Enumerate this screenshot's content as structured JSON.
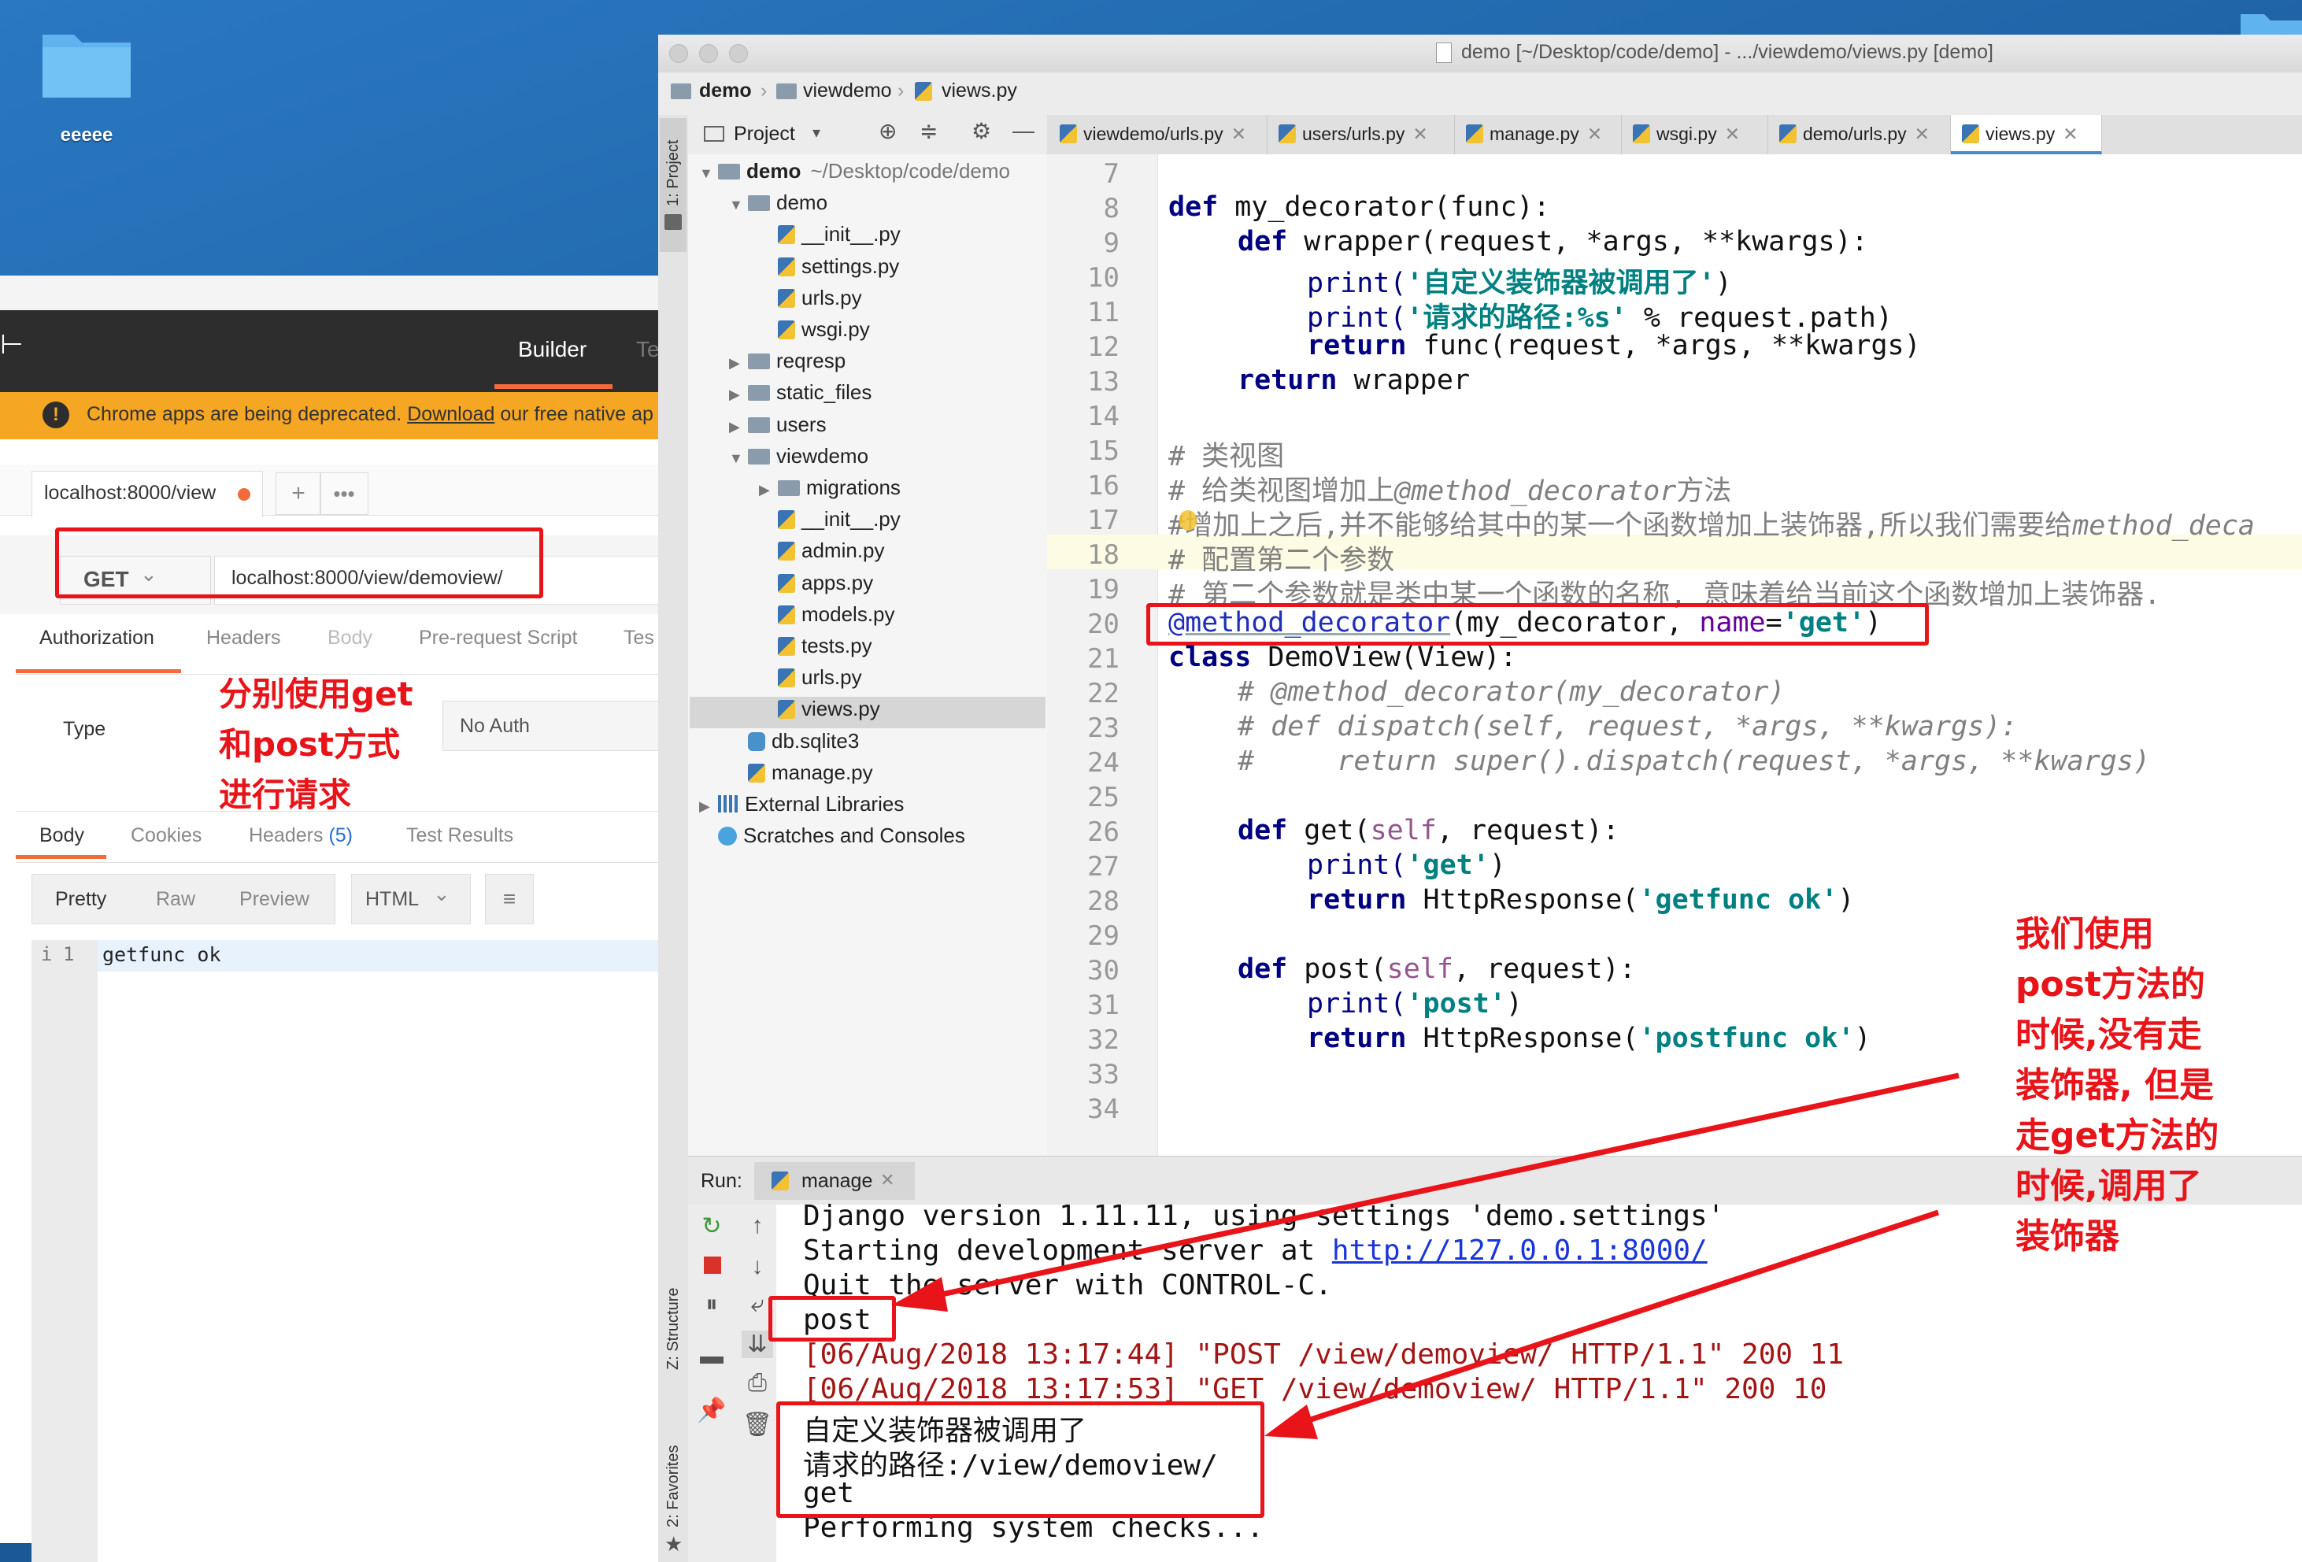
{
  "desktop": {
    "folder_label": "eeeee"
  },
  "postman": {
    "builder_tab": "Builder",
    "partial_tab": "Te",
    "banner": {
      "text_before": "Chrome apps are being deprecated.",
      "link": "Download",
      "text_after": "our free native ap"
    },
    "request_tab": "localhost:8000/view",
    "method": "GET",
    "url": "localhost:8000/view/demoview/",
    "request_tabs": [
      "Authorization",
      "Headers",
      "Body",
      "Pre-request Script",
      "Tes"
    ],
    "auth_type_label": "Type",
    "auth_type_value": "No Auth",
    "annotation": [
      "分别使用get",
      "和post方式",
      "进行请求"
    ],
    "response_tabs": {
      "body": "Body",
      "cookies": "Cookies",
      "headers": "Headers",
      "headers_count": "(5)",
      "test_results": "Test Results"
    },
    "formats": [
      "Pretty",
      "Raw",
      "Preview"
    ],
    "format_select": "HTML",
    "response_line_no": "1",
    "response_body": "getfunc ok"
  },
  "pycharm": {
    "window_title": "demo [~/Desktop/code/demo] - .../viewdemo/views.py [demo]",
    "breadcrumbs": [
      "demo",
      "viewdemo",
      "views.py"
    ],
    "project_label": "Project",
    "side_label_project": "1: Project",
    "side_label_structure": "Z: Structure",
    "side_label_favorites": "2: Favorites",
    "tree": [
      {
        "label": "demo",
        "hint": "~/Desktop/code/demo",
        "type": "folder",
        "depth": 0,
        "open": true
      },
      {
        "label": "demo",
        "type": "folder",
        "depth": 1,
        "open": true
      },
      {
        "label": "__init__.py",
        "type": "py",
        "depth": 2
      },
      {
        "label": "settings.py",
        "type": "py",
        "depth": 2
      },
      {
        "label": "urls.py",
        "type": "py",
        "depth": 2
      },
      {
        "label": "wsgi.py",
        "type": "py",
        "depth": 2
      },
      {
        "label": "reqresp",
        "type": "folder",
        "depth": 1,
        "open": false
      },
      {
        "label": "static_files",
        "type": "folder",
        "depth": 1,
        "open": false
      },
      {
        "label": "users",
        "type": "folder",
        "depth": 1,
        "open": false
      },
      {
        "label": "viewdemo",
        "type": "folder",
        "depth": 1,
        "open": true
      },
      {
        "label": "migrations",
        "type": "folder",
        "depth": 2,
        "open": false
      },
      {
        "label": "__init__.py",
        "type": "py",
        "depth": 2
      },
      {
        "label": "admin.py",
        "type": "py",
        "depth": 2
      },
      {
        "label": "apps.py",
        "type": "py",
        "depth": 2
      },
      {
        "label": "models.py",
        "type": "py",
        "depth": 2
      },
      {
        "label": "tests.py",
        "type": "py",
        "depth": 2
      },
      {
        "label": "urls.py",
        "type": "py",
        "depth": 2
      },
      {
        "label": "views.py",
        "type": "py",
        "depth": 2,
        "selected": true
      },
      {
        "label": "db.sqlite3",
        "type": "db",
        "depth": 1
      },
      {
        "label": "manage.py",
        "type": "py",
        "depth": 1
      },
      {
        "label": "External Libraries",
        "type": "lib",
        "depth": 0,
        "open": false
      },
      {
        "label": "Scratches and Consoles",
        "type": "scratch",
        "depth": 0
      }
    ],
    "editor_tabs": [
      "viewdemo/urls.py",
      "users/urls.py",
      "manage.py",
      "wsgi.py",
      "demo/urls.py",
      "views.py"
    ],
    "active_tab": "views.py",
    "line_numbers": [
      "7",
      "8",
      "9",
      "10",
      "11",
      "12",
      "13",
      "14",
      "15",
      "16",
      "17",
      "18",
      "19",
      "20",
      "21",
      "22",
      "23",
      "24",
      "25",
      "26",
      "27",
      "28",
      "29",
      "30",
      "31",
      "32",
      "33",
      "34"
    ],
    "code": {
      "l8_kw": "def",
      "l8": " my_decorator(func):",
      "l9_kw": "def",
      "l9": " wrapper(request, *args, **kwargs):",
      "l10_fn": "print(",
      "l10_str": "'自定义装饰器被调用了'",
      "l10_end": ")",
      "l11_fn": "print(",
      "l11_str": "'请求的路径:%s'",
      "l11_end": " % request.path)",
      "l12_kw": "return",
      "l12": " func(request, *args, **kwargs)",
      "l13_kw": "return",
      "l13": " wrapper",
      "l15": "# 类视图",
      "l16_a": "# 给类视图增加上",
      "l16_b": "@method_decorator",
      "l16_c": "方法",
      "l17_a": "#增加上之后,并不能够给其中的某一个函数增加上装饰器,所以我们需要给",
      "l17_b": "method_deca",
      "l18": "# 配置第二个参数",
      "l19": "# 第二个参数就是类中某一个函数的名称, 意味着给当前这个函数增加上装饰器.",
      "l20_dec": "@method_decorator",
      "l20_a": "(my_decorator, ",
      "l20_name": "name",
      "l20_eq": "=",
      "l20_str": "'get'",
      "l20_end": ")",
      "l21_kw": "class",
      "l21": " DemoView(View):",
      "l22": "# @method_decorator(my_decorator)",
      "l23": "# def dispatch(self, request, *args, **kwargs):",
      "l24": "#     return super().dispatch(request, *args, **kwargs)",
      "l26_kw": "def",
      "l26_a": " get(",
      "l26_self": "self",
      "l26_b": ", request):",
      "l27_fn": "print(",
      "l27_str": "'get'",
      "l27_end": ")",
      "l28_kw": "return",
      "l28_a": " HttpResponse(",
      "l28_str": "'getfunc ok'",
      "l28_end": ")",
      "l30_kw": "def",
      "l30_a": " post(",
      "l30_self": "self",
      "l30_b": ", request):",
      "l31_fn": "print(",
      "l31_str": "'post'",
      "l31_end": ")",
      "l32_kw": "return",
      "l32_a": " HttpResponse(",
      "l32_str": "'postfunc ok'",
      "l32_end": ")"
    },
    "run": {
      "label": "Run:",
      "tab": "manage",
      "console": [
        {
          "text": "Django version 1.11.11, using settings 'demo.settings'",
          "color": "normal"
        },
        {
          "text": "Starting development server at ",
          "link": "http://127.0.0.1:8000/",
          "color": "normal"
        },
        {
          "text": "Quit the server with CONTROL-C.",
          "color": "normal"
        },
        {
          "text": "post",
          "color": "normal"
        },
        {
          "text": "[06/Aug/2018 13:17:44] \"POST /view/demoview/ HTTP/1.1\" 200 11",
          "color": "red"
        },
        {
          "text": "[06/Aug/2018 13:17:53] \"GET /view/demoview/ HTTP/1.1\" 200 10",
          "color": "red"
        },
        {
          "text": "自定义装饰器被调用了",
          "color": "normal"
        },
        {
          "text": "请求的路径:/view/demoview/",
          "color": "normal"
        },
        {
          "text": "get",
          "color": "normal"
        },
        {
          "text": "Performing system checks...",
          "color": "normal"
        }
      ]
    },
    "annotation": [
      "我们使用",
      "post方法的",
      "时候,没有走",
      "装饰器, 但是",
      "走get方法的",
      "时候,调用了",
      "装饰器"
    ]
  },
  "colors": {
    "annotation_red": "#e8141a",
    "postman_accent": "#f26b3a",
    "banner": "#f5a623",
    "keyword": "#000080",
    "string": "#008080"
  }
}
